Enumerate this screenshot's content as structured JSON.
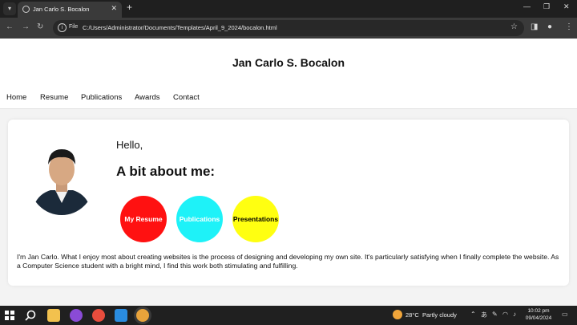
{
  "browser": {
    "tab_title": "Jan Carlo S. Bocalon",
    "new_tab_symbol": "+",
    "address_chip": "File",
    "url": "C:/Users/Administrator/Documents/Templates/April_9_2024/bocalon.html"
  },
  "site": {
    "title": "Jan Carlo S. Bocalon",
    "nav": [
      "Home",
      "Resume",
      "Publications",
      "Awards",
      "Contact"
    ]
  },
  "intro": {
    "greeting": "Hello,",
    "heading": "A bit about me:",
    "buttons": [
      {
        "label": "My Resume",
        "color": "#ff1111",
        "text_color": "#ffffff"
      },
      {
        "label": "Publications",
        "color": "#1ef2f8",
        "text_color": "#ffffff"
      },
      {
        "label": "Presentations",
        "color": "#ffff11",
        "text_color": "#000000"
      }
    ],
    "description": "I'm Jan Carlo. What I enjoy most about creating websites is the process of designing and developing my own site. It's particularly satisfying when I finally complete the website. As a Computer Science student with a bright mind, I find this work both stimulating and fulfilling."
  },
  "taskbar": {
    "weather_temp": "28°C",
    "weather_text": "Partly cloudy",
    "time": "10:02 pm",
    "date": "09/04/2024"
  }
}
